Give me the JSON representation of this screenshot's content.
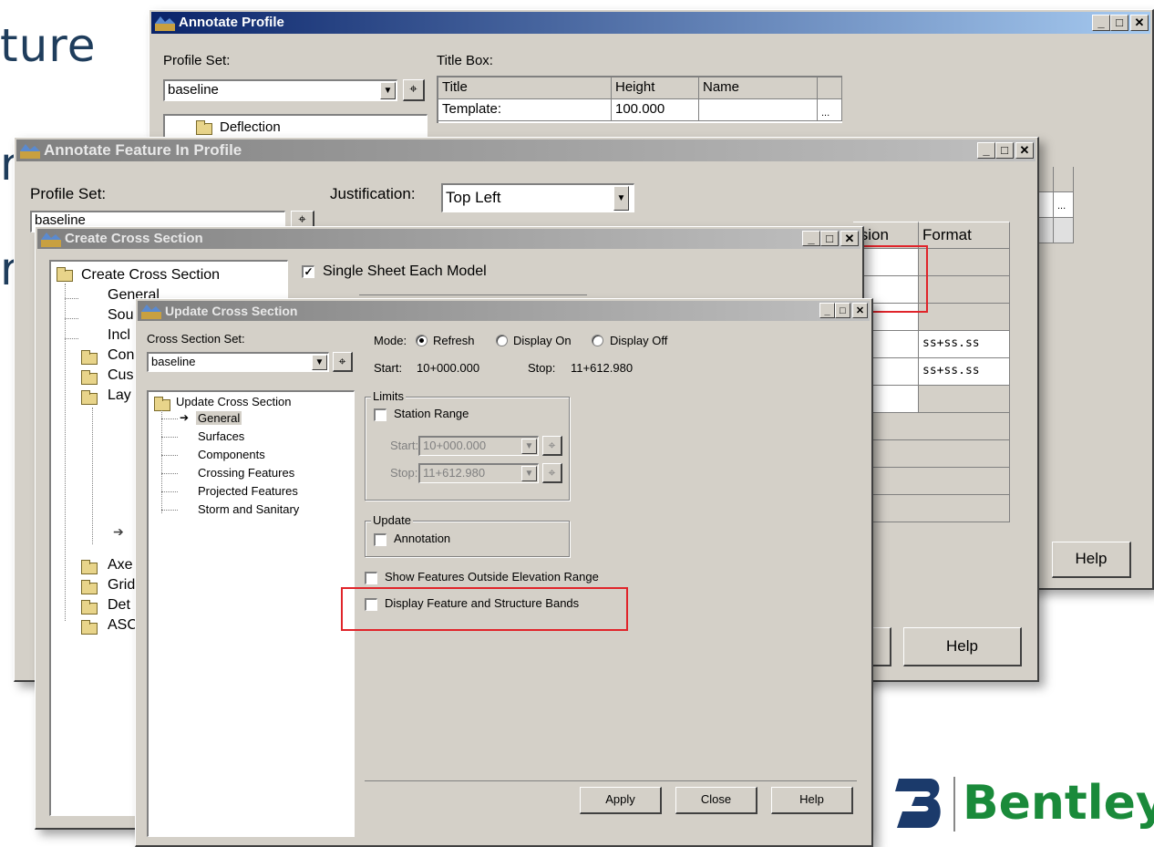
{
  "slide": {
    "bg_text": [
      "ture",
      "n",
      "r"
    ],
    "brand": "Bentley",
    "brand_color": "#1a8a3a"
  },
  "annotate_profile": {
    "title": "Annotate Profile",
    "profile_set_label": "Profile Set:",
    "profile_set_value": "baseline",
    "tree_item": "Deflection",
    "title_box_label": "Title Box:",
    "columns": [
      "Title",
      "Height",
      "Name"
    ],
    "row": [
      "Template:",
      "100.000",
      ""
    ],
    "ellipsis": "...",
    "help": "Help"
  },
  "annotate_feature": {
    "title": "Annotate Feature In Profile",
    "profile_set_label": "Profile Set:",
    "profile_set_value": "baseline",
    "justification_label": "Justification:",
    "justification_value": "Top Left",
    "columns": [
      "ision",
      "Format"
    ],
    "format_values": [
      "",
      "",
      "",
      "ss+ss.ss",
      "ss+ss.ss"
    ],
    "help": "Help"
  },
  "create_cross_section": {
    "title": "Create Cross Section",
    "single_sheet_label": "Single Sheet Each Model",
    "single_sheet_checked": true,
    "tree": [
      {
        "label": "Create Cross Section",
        "folder": true
      },
      {
        "label": "General"
      },
      {
        "label": "Sou"
      },
      {
        "label": "Incl"
      },
      {
        "label": "Con",
        "folder": true
      },
      {
        "label": "Cus",
        "folder": true
      },
      {
        "label": "Lay",
        "folder": true
      },
      {
        "label": "Axe",
        "folder": true
      },
      {
        "label": "Grid",
        "folder": true
      },
      {
        "label": "Det",
        "folder": true
      },
      {
        "label": "ASC",
        "folder": true
      }
    ]
  },
  "update_cross_section": {
    "title": "Update Cross Section",
    "set_label": "Cross Section Set:",
    "set_value": "baseline",
    "mode_label": "Mode:",
    "modes": [
      "Refresh",
      "Display On",
      "Display Off"
    ],
    "mode_selected": "Refresh",
    "start_label": "Start:",
    "start_value": "10+000.000",
    "stop_label": "Stop:",
    "stop_value": "11+612.980",
    "tree_root": "Update Cross Section",
    "tree_items": [
      "General",
      "Surfaces",
      "Components",
      "Crossing Features",
      "Projected Features",
      "Storm and Sanitary"
    ],
    "tree_selected": "General",
    "limits_group": "Limits",
    "station_range_label": "Station Range",
    "station_range_checked": false,
    "limit_start_label": "Start:",
    "limit_start_value": "10+000.000",
    "limit_stop_label": "Stop:",
    "limit_stop_value": "11+612.980",
    "update_group": "Update",
    "annotation_label": "Annotation",
    "annotation_checked": false,
    "show_outside_label": "Show Features Outside Elevation Range",
    "show_outside_checked": false,
    "display_bands_label": "Display Feature and Structure Bands",
    "display_bands_checked": false,
    "apply": "Apply",
    "close": "Close",
    "help": "Help"
  },
  "colors": {
    "title_active": "#0a246a",
    "title_inactive": "#808080",
    "highlight": "#e0242a",
    "slide_text": "#1f3d5c"
  }
}
